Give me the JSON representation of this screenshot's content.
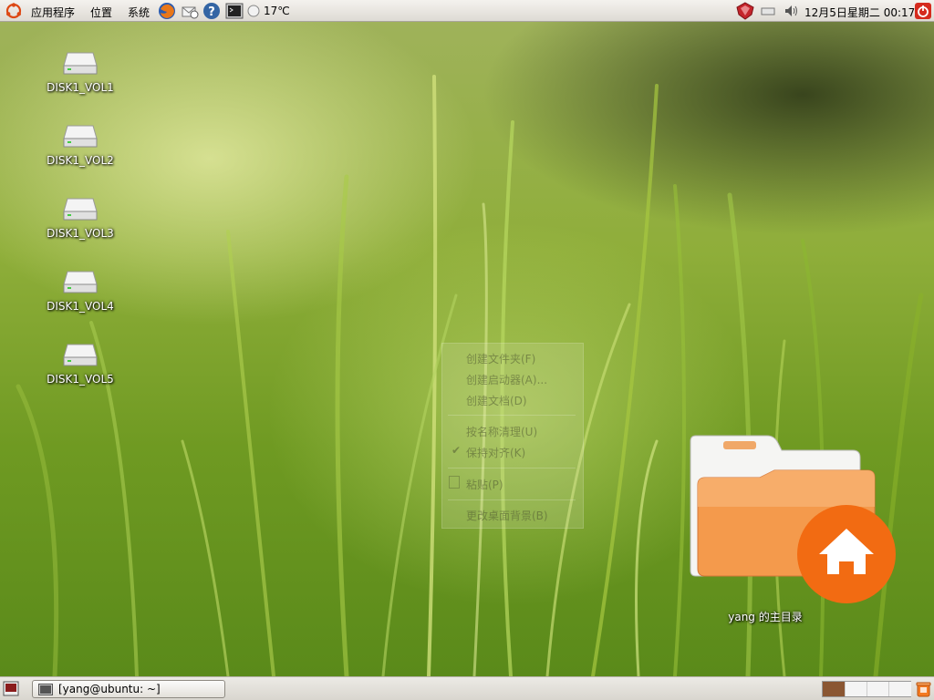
{
  "top_panel": {
    "menus": [
      "应用程序",
      "位置",
      "系统"
    ],
    "weather": "17℃",
    "clock": "12月5日星期二 00:17",
    "icons": [
      "ubuntu-logo-icon",
      "firefox-icon",
      "mail-icon",
      "help-icon",
      "terminal-icon",
      "weather-icon",
      "network-icon",
      "drive-icon",
      "volume-icon",
      "power-icon"
    ]
  },
  "desktop": {
    "drives": [
      {
        "label": "DISK1_VOL1"
      },
      {
        "label": "DISK1_VOL2"
      },
      {
        "label": "DISK1_VOL3"
      },
      {
        "label": "DISK1_VOL4"
      },
      {
        "label": "DISK1_VOL5"
      }
    ],
    "home_folder": {
      "label": "yang 的主目录"
    }
  },
  "context_menu": {
    "items": [
      {
        "label": "创建文件夹(F)"
      },
      {
        "label": "创建启动器(A)..."
      },
      {
        "label": "创建文档(D)"
      },
      {
        "label": "按名称清理(U)"
      },
      {
        "label": "保持对齐(K)"
      },
      {
        "label": "粘贴(P)"
      },
      {
        "label": "更改桌面背景(B)"
      }
    ]
  },
  "bottom_panel": {
    "task_button": "[yang@ubuntu: ~]",
    "workspace_active_color": "#8a5632"
  }
}
